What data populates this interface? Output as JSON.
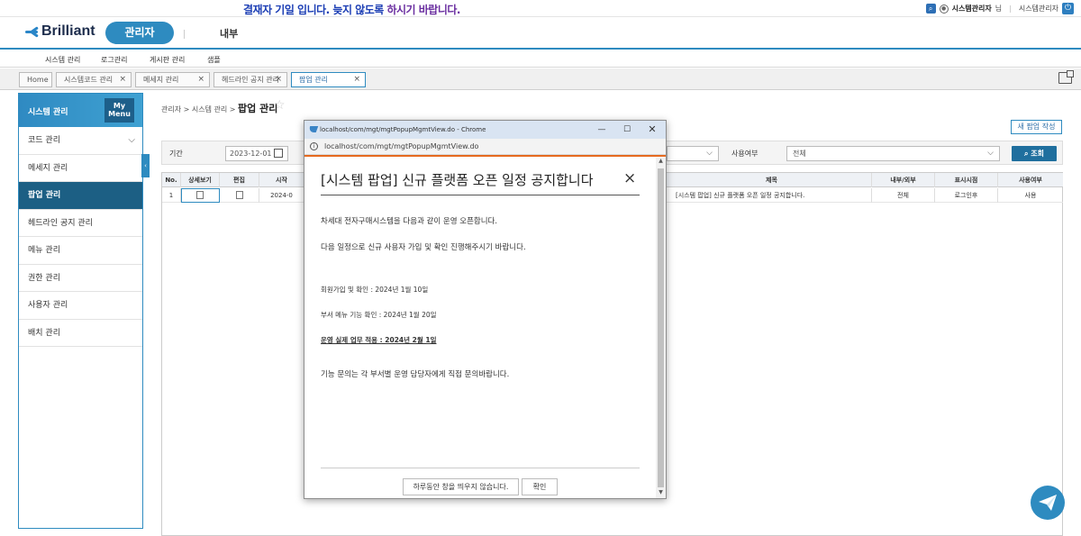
{
  "notice": {
    "part1": "결재자 기일 입니다. 늦지 않도록 ",
    "part2": "하시기 바랍니다."
  },
  "user": {
    "name": "시스템관리자",
    "suffix": "님",
    "role": "시스템관리자"
  },
  "logo": {
    "text": "Brilliant"
  },
  "gnb": {
    "active": "관리자",
    "other": "내부"
  },
  "submenu": [
    "시스템 관리",
    "로그관리",
    "게시판 관리",
    "샘플"
  ],
  "tabs": [
    {
      "label": "Home"
    },
    {
      "label": "시스템코드 관리"
    },
    {
      "label": "메세지 관리"
    },
    {
      "label": "헤드라인 공지 관리"
    },
    {
      "label": "팝업 관리"
    }
  ],
  "sidebar": {
    "title": "시스템 관리",
    "mymenu": [
      "My",
      "Menu"
    ],
    "items": [
      "코드 관리",
      "메세지 관리",
      "팝업 관리",
      "헤드라인 공지 관리",
      "메뉴 관리",
      "권한 관리",
      "사용자 관리",
      "배치 관리"
    ]
  },
  "breadcrumb": {
    "path": "관리자 > 시스템 관리 > ",
    "current": "팝업 관리"
  },
  "buttons": {
    "new": "새 팝업 작성",
    "search": "조회"
  },
  "search": {
    "period_label": "기간",
    "date_from": "2023-12-01",
    "use_label": "사용여부",
    "use_value": "전체"
  },
  "grid": {
    "headers": [
      "No.",
      "상세보기",
      "편집",
      "시작",
      "제목",
      "내부/외부",
      "표시시점",
      "사용여부"
    ],
    "rows": [
      {
        "no": "1",
        "start": "2024-0",
        "title": "[시스템 팝업] 신규 플랫폼 오픈 일정 공지합니다.",
        "scope": "전체",
        "timing": "로그인후",
        "use": "사용"
      }
    ]
  },
  "popup": {
    "window_title": "localhost/com/mgt/mgtPopupMgmtView.do - Chrome",
    "url": "localhost/com/mgt/mgtPopupMgmtView.do",
    "heading": "[시스템 팝업] 신규 플랫폼 오픈 일정 공지합니다",
    "lines": [
      "차세대 전자구매시스템을 다음과 같이 운영 오픈합니다.",
      "다음 일정으로 신규 사용자 가입 및 확인 진행해주시기 바랍니다.",
      "회원가입 및 확인 : 2024년 1월 10일",
      "부서 메뉴 기능 확인 : 2024년 1월 20일",
      "운영 실제 업무 적용 : 2024년 2월 1일",
      "기능 문의는 각 부서별 운영 담당자에게 직접 문의바랍니다."
    ],
    "btn_hide_today": "하루동안 창을 띄우지 않습니다.",
    "btn_confirm": "확인"
  },
  "colors": {
    "accent": "#2e8bc0",
    "dark": "#1c5f84",
    "notice": "#1d3fb5"
  }
}
